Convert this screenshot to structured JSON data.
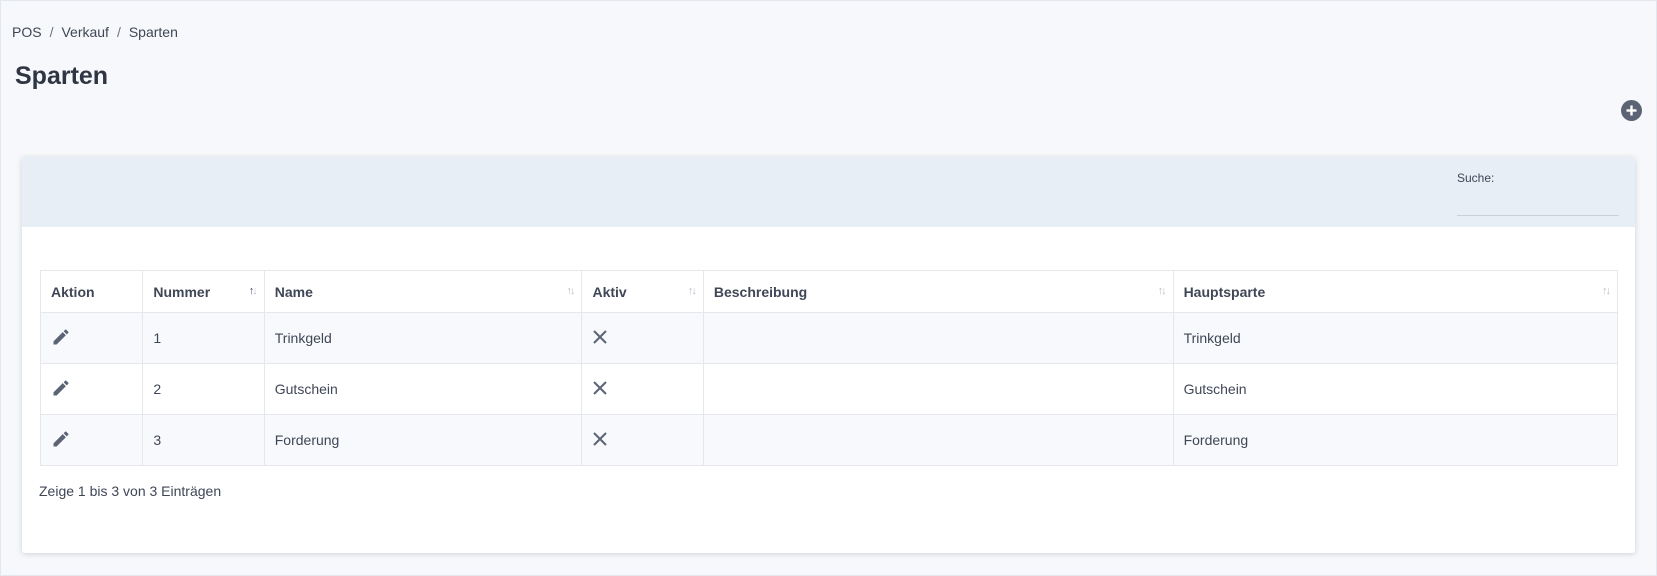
{
  "breadcrumb": {
    "items": [
      "POS",
      "Verkauf",
      "Sparten"
    ],
    "separator": "/"
  },
  "page": {
    "title": "Sparten"
  },
  "search": {
    "label": "Suche:",
    "value": ""
  },
  "table": {
    "headers": {
      "aktion": "Aktion",
      "nummer": "Nummer",
      "name": "Name",
      "aktiv": "Aktiv",
      "beschreibung": "Beschreibung",
      "hauptsparte": "Hauptsparte"
    },
    "sort_column": "nummer",
    "rows": [
      {
        "nummer": "1",
        "name": "Trinkgeld",
        "aktiv": "x-icon",
        "beschreibung": "",
        "hauptsparte": "Trinkgeld"
      },
      {
        "nummer": "2",
        "name": "Gutschein",
        "aktiv": "x-icon",
        "beschreibung": "",
        "hauptsparte": "Gutschein"
      },
      {
        "nummer": "3",
        "name": "Forderung",
        "aktiv": "x-icon",
        "beschreibung": "",
        "hauptsparte": "Forderung"
      }
    ]
  },
  "footer": {
    "info": "Zeige 1 bis 3 von 3 Einträgen"
  },
  "icons": {
    "add": "plus-circle-icon",
    "edit": "pencil-icon",
    "inactive": "x-icon"
  },
  "colors": {
    "accent": "#5b6374",
    "header_band": "#e8eef6",
    "background": "#f6f8fb"
  }
}
